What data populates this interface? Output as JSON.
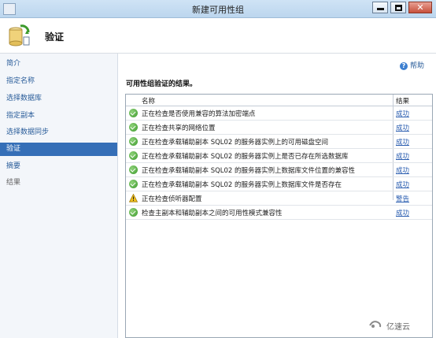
{
  "window": {
    "title": "新建可用性组"
  },
  "header": {
    "title": "验证"
  },
  "nav": {
    "items": [
      {
        "label": "简介",
        "state": "link"
      },
      {
        "label": "指定名称",
        "state": "link"
      },
      {
        "label": "选择数据库",
        "state": "link"
      },
      {
        "label": "指定副本",
        "state": "link"
      },
      {
        "label": "选择数据同步",
        "state": "link"
      },
      {
        "label": "验证",
        "state": "active"
      },
      {
        "label": "摘要",
        "state": "link"
      },
      {
        "label": "结果",
        "state": "disabled"
      }
    ]
  },
  "help": {
    "label": "帮助"
  },
  "main": {
    "section_title": "可用性组验证的结果。"
  },
  "grid": {
    "columns": {
      "name": "名称",
      "result": "结果"
    },
    "rows": [
      {
        "status": "success-icon",
        "text": "正在检查是否使用兼容的算法加密端点",
        "result": "成功"
      },
      {
        "status": "success-icon",
        "text": "正在检查共享的网络位置",
        "result": "成功"
      },
      {
        "status": "success-icon",
        "text": "正在检查承载辅助副本 SQL02 的服务器实例上的可用磁盘空间",
        "result": "成功"
      },
      {
        "status": "success-icon",
        "text": "正在检查承载辅助副本 SQL02 的服务器实例上是否已存在所选数据库",
        "result": "成功"
      },
      {
        "status": "success-icon",
        "text": "正在检查承载辅助副本 SQL02 的服务器实例上数据库文件位置的兼容性",
        "result": "成功"
      },
      {
        "status": "success-icon",
        "text": "正在检查承载辅助副本 SQL02 的服务器实例上数据库文件是否存在",
        "result": "成功"
      },
      {
        "status": "warning-icon",
        "text": "正在检查侦听器配置",
        "result": "警告"
      },
      {
        "status": "success-icon",
        "text": "检查主副本和辅助副本之间的可用性模式兼容性",
        "result": "成功"
      }
    ]
  },
  "watermark": {
    "text": "亿速云"
  },
  "colors": {
    "nav_active": "#356fb7",
    "link": "#2a5db0",
    "success": "#3c9a2c",
    "warning": "#f2c11d"
  }
}
